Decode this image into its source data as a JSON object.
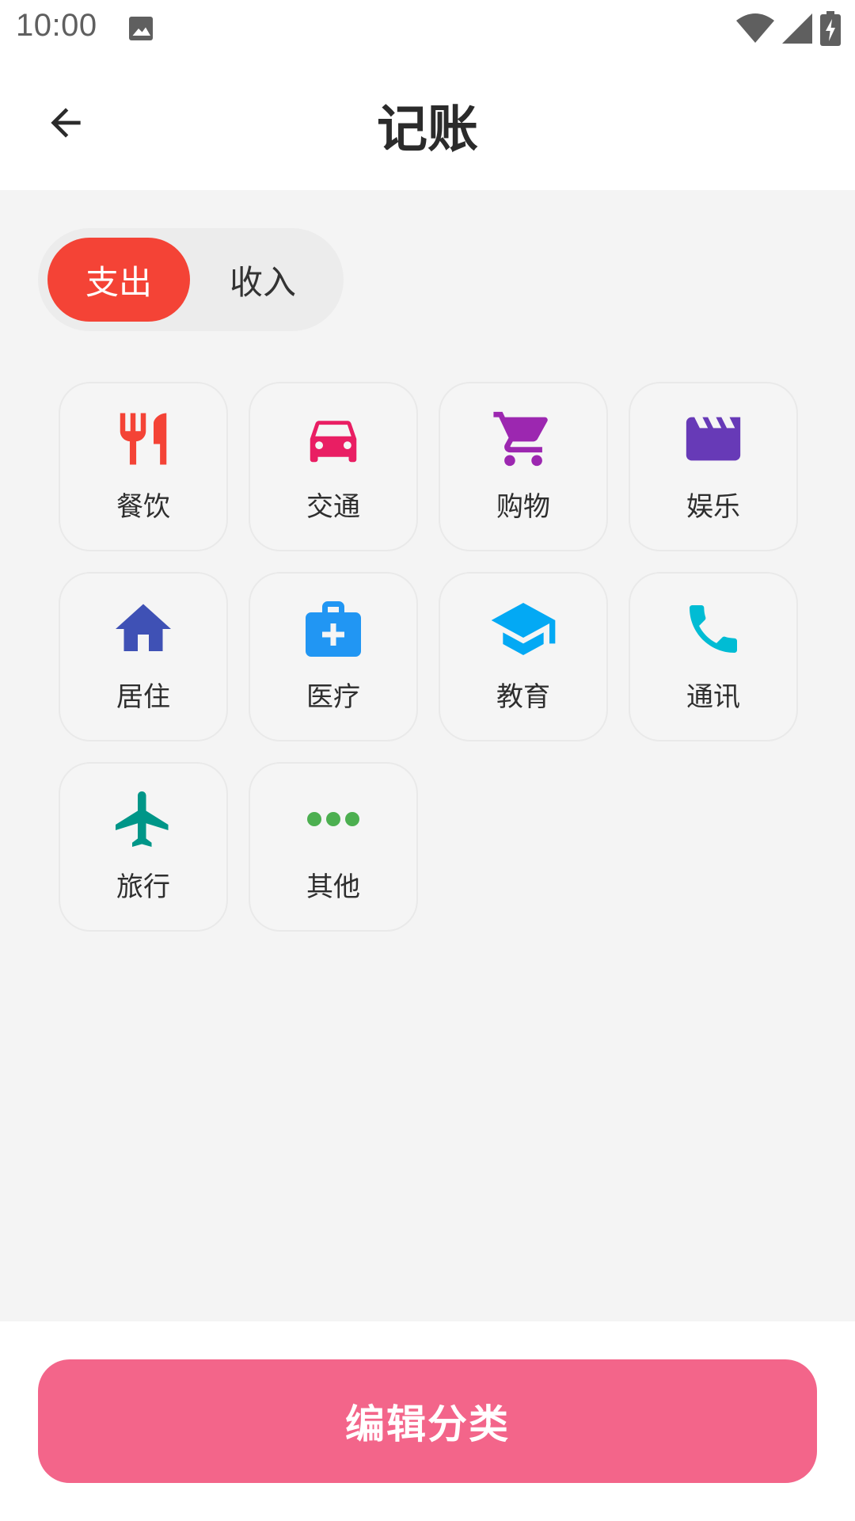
{
  "status_bar": {
    "time": "10:00",
    "icons": [
      "image-icon",
      "wifi-icon",
      "signal-icon",
      "battery-charging-icon"
    ]
  },
  "app_bar": {
    "title": "记账",
    "back_icon": "arrow-left-icon"
  },
  "toggle": {
    "expense_label": "支出",
    "income_label": "收入",
    "selected": "expense",
    "active_color": "#f44336"
  },
  "categories": [
    {
      "label": "餐饮",
      "icon": "restaurant-icon",
      "color": "#f44336"
    },
    {
      "label": "交通",
      "icon": "car-icon",
      "color": "#e91e63"
    },
    {
      "label": "购物",
      "icon": "shopping-cart-icon",
      "color": "#9c27b0"
    },
    {
      "label": "娱乐",
      "icon": "movie-clapper-icon",
      "color": "#673ab7"
    },
    {
      "label": "居住",
      "icon": "home-icon",
      "color": "#3f51b5"
    },
    {
      "label": "医疗",
      "icon": "medical-kit-icon",
      "color": "#2196f3"
    },
    {
      "label": "教育",
      "icon": "graduation-cap-icon",
      "color": "#03a9f4"
    },
    {
      "label": "通讯",
      "icon": "phone-icon",
      "color": "#00bcd4"
    },
    {
      "label": "旅行",
      "icon": "airplane-icon",
      "color": "#009688"
    },
    {
      "label": "其他",
      "icon": "more-horizontal-icon",
      "color": "#4caf50"
    }
  ],
  "bottom": {
    "edit_label": "编辑分类",
    "button_color": "#f3658a"
  }
}
